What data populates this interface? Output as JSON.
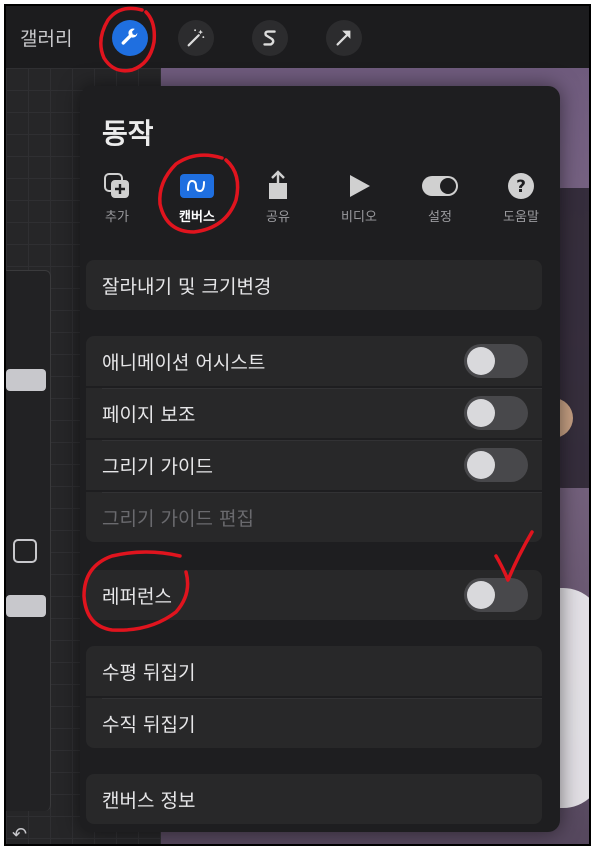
{
  "topbar": {
    "gallery": "갤러리",
    "tools": [
      {
        "icon": "wrench-icon",
        "active": true
      },
      {
        "icon": "magic-wand-icon",
        "active": false
      },
      {
        "icon": "selection-s-icon",
        "active": false
      },
      {
        "icon": "transform-arrow-icon",
        "active": false
      }
    ]
  },
  "panel": {
    "title": "동작",
    "tabs": [
      {
        "label": "추가",
        "icon": "add-layers-icon"
      },
      {
        "label": "캔버스",
        "icon": "canvas-wave-icon",
        "active": true
      },
      {
        "label": "공유",
        "icon": "share-icon"
      },
      {
        "label": "비디오",
        "icon": "play-icon"
      },
      {
        "label": "설정",
        "icon": "toggle-icon"
      },
      {
        "label": "도움말",
        "icon": "help-icon"
      }
    ],
    "crop": "잘라내기 및 크기변경",
    "animation_assist": "애니메이션 어시스트",
    "page_assist": "페이지 보조",
    "drawing_guide": "그리기 가이드",
    "edit_drawing_guide": "그리기 가이드 편집",
    "reference": "레퍼런스",
    "flip_horizontal": "수평 뒤집기",
    "flip_vertical": "수직 뒤집기",
    "canvas_info": "캔버스 정보"
  },
  "colors": {
    "accent": "#1f6fe0",
    "annotation": "#e0141e",
    "panel": "#1e1e20",
    "row": "#282829"
  }
}
